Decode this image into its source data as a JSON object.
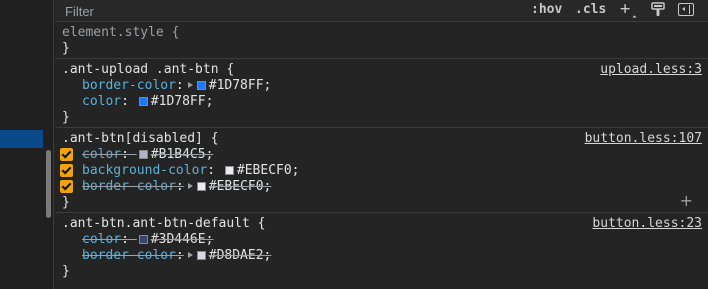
{
  "filter": {
    "placeholder": "Filter"
  },
  "toolbar": {
    "hov": ":hov",
    "cls": ".cls",
    "add": "+"
  },
  "rules": [
    {
      "selector": "element.style {",
      "close": "}"
    },
    {
      "selector": ".ant-upload .ant-btn {",
      "source": "upload.less:3",
      "close": "}",
      "decls": [
        {
          "prop": "border-color",
          "value": "#1D78FF;",
          "color": "#1D78FF"
        },
        {
          "prop": "color",
          "value": "#1D78FF;",
          "color": "#1D78FF"
        }
      ]
    },
    {
      "selector": ".ant-btn[disabled] {",
      "source": "button.less:107",
      "close": "}",
      "decls": [
        {
          "prop": "color",
          "value": "#B1B4C5;",
          "color": "#B1B4C5",
          "struck": true
        },
        {
          "prop": "background-color",
          "value": "#EBECF0;",
          "color": "#EBECF0"
        },
        {
          "prop": "border-color",
          "value": "#EBECF0;",
          "color": "#EBECF0",
          "struck": true
        }
      ]
    },
    {
      "selector": ".ant-btn.ant-btn-default {",
      "source": "button.less:23",
      "close": "}",
      "decls": [
        {
          "prop": "color",
          "value": "#3D446E;",
          "color": "#3D446E",
          "struck": true
        },
        {
          "prop": "border-color",
          "value": "#D8DAE2;",
          "color": "#D8DAE2",
          "struck": true
        }
      ]
    }
  ],
  "sep": ":"
}
